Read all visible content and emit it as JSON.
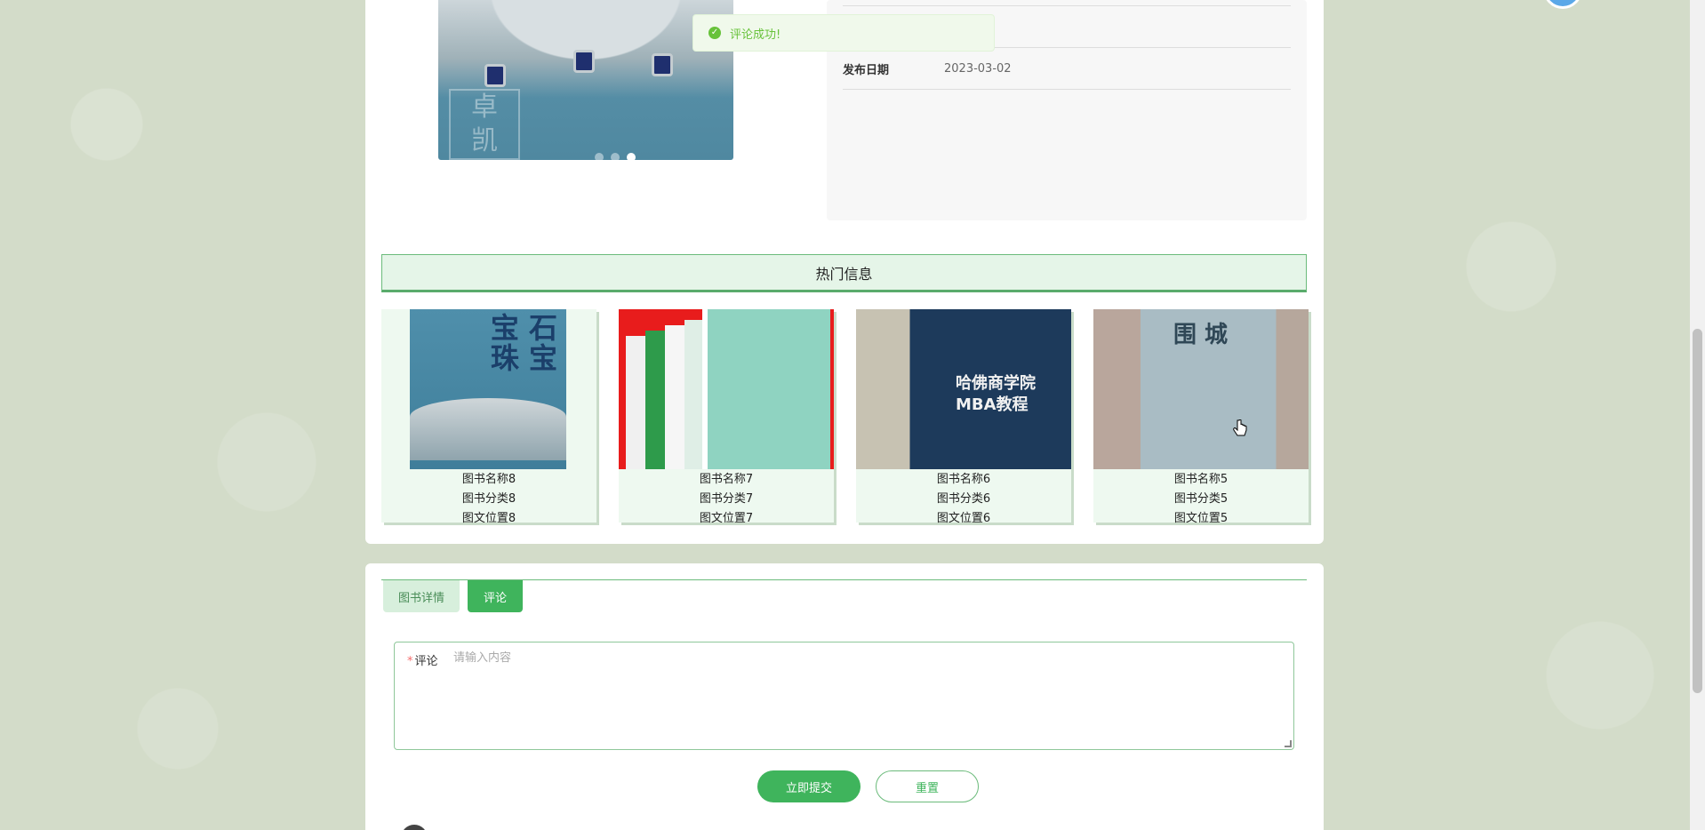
{
  "toast": {
    "message": "评论成功!"
  },
  "info": {
    "rows": [
      {
        "label": "",
        "value": ""
      },
      {
        "label": "发布日期",
        "value": "2023-03-02"
      }
    ]
  },
  "hot": {
    "title": "热门信息",
    "items": [
      {
        "name": "图书名称8",
        "category": "图书分类8",
        "position": "图文位置8"
      },
      {
        "name": "图书名称7",
        "category": "图书分类7",
        "position": "图文位置7"
      },
      {
        "name": "图书名称6",
        "category": "图书分类6",
        "position": "图文位置6"
      },
      {
        "name": "图书名称5",
        "category": "图书分类5",
        "position": "图文位置5"
      }
    ],
    "cover_texts": {
      "item1": "宝石珠宝",
      "item3": "哈佛商学院 MBA教程",
      "item4": "围城"
    }
  },
  "tabs": [
    {
      "label": "图书详情",
      "active": false
    },
    {
      "label": "评论",
      "active": true
    }
  ],
  "comment": {
    "label": "评论",
    "required_mark": "*",
    "placeholder": "请输入内容",
    "value": ""
  },
  "buttons": {
    "submit": "立即提交",
    "reset": "重置"
  },
  "colors": {
    "accent": "#3fb45c",
    "toast_bg": "#f0f9eb",
    "toast_text": "#67c23a"
  }
}
